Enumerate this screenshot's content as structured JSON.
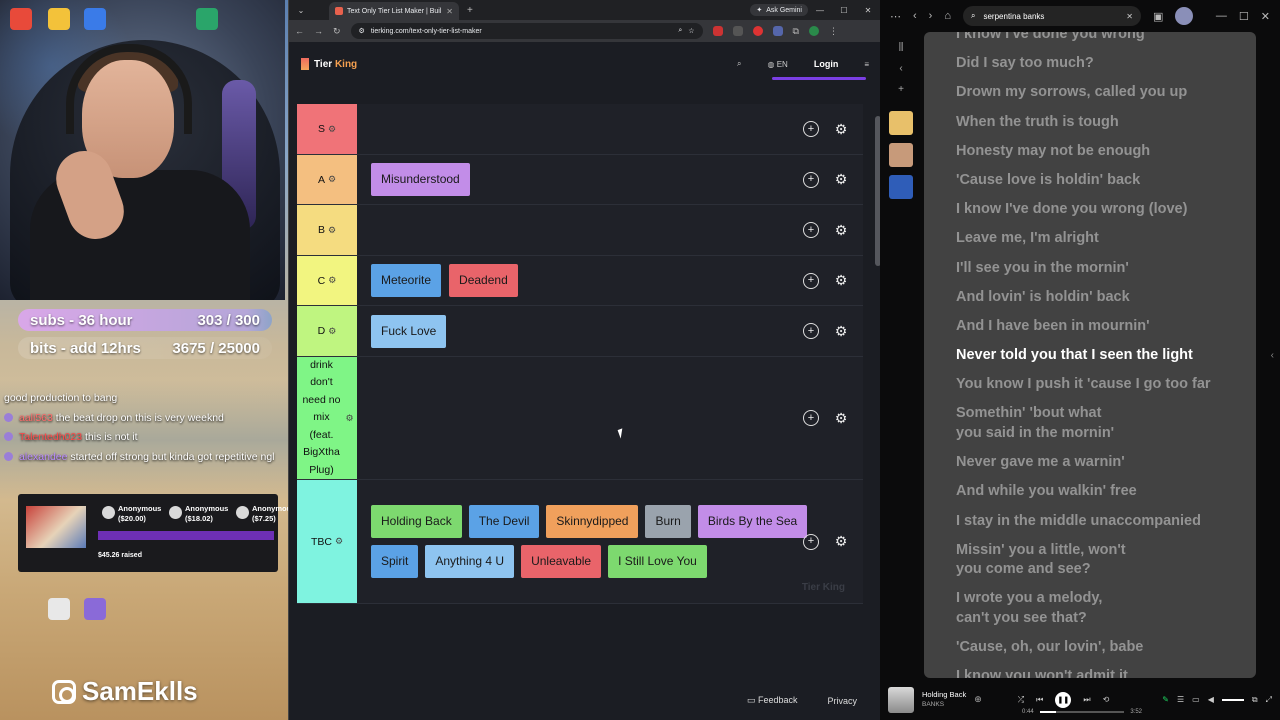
{
  "overlay": {
    "subs_label": "subs - 36 hour",
    "subs_count": "303 / 300",
    "bits_label": "bits - add 12hrs",
    "bits_count": "3675 / 25000",
    "chat": [
      {
        "user": "",
        "text": "good production to bang"
      },
      {
        "user": "aali563",
        "text": "the beat drop on this is very weeknd"
      },
      {
        "user": "Talentedh023",
        "text": "this is not it"
      },
      {
        "user": "alexandee",
        "text": "started off strong but kinda got repetitive ngl"
      }
    ],
    "donations": [
      {
        "name": "Anonymous",
        "amount": "($20.00)"
      },
      {
        "name": "Anonymous",
        "amount": "($18.02)"
      },
      {
        "name": "Anonymou",
        "amount": "($7.25)"
      }
    ],
    "donation_raised": "$45.26 raised",
    "handle": "SamEklls",
    "desktop_icons": [
      "#e84a3a",
      "#f3c23a",
      "#3a7be8",
      "#2aa56a",
      "#e8e8e8",
      "#8a6ad8"
    ]
  },
  "browser": {
    "tab_title": "Text Only Tier List Maker | Buil",
    "gemini": "Ask Gemini",
    "url": "tierking.com/text-only-tier-list-maker",
    "site": {
      "logo_a": "Tier ",
      "logo_b": "King",
      "lang": "EN",
      "login": "Login",
      "feedback": "Feedback",
      "privacy": "Privacy",
      "watermark": "Tier King"
    },
    "tiers": [
      {
        "label": "S",
        "color": "#f07378",
        "height": 51,
        "items": []
      },
      {
        "label": "A",
        "color": "#f4bf80",
        "height": 50,
        "items": [
          {
            "text": "Misunderstood",
            "color": "#c28de8"
          }
        ]
      },
      {
        "label": "B",
        "color": "#f5dc80",
        "height": 51,
        "items": []
      },
      {
        "label": "C",
        "color": "#f2f580",
        "height": 50,
        "items": [
          {
            "text": "Meteorite",
            "color": "#5ba2e6"
          },
          {
            "text": "Deadend",
            "color": "#e9646a"
          }
        ]
      },
      {
        "label": "D",
        "color": "#bff580",
        "height": 51,
        "items": [
          {
            "text": "Fuck Love",
            "color": "#8ec4f0"
          }
        ]
      },
      {
        "label": "drink don't need no mix (feat. BigXtha Plug)",
        "color": "#7ff586",
        "height": 123,
        "items": []
      },
      {
        "label": "TBC",
        "color": "#7ff3e0",
        "height": 124,
        "items": [
          {
            "text": "Holding Back",
            "color": "#7dd96f"
          },
          {
            "text": "The Devil",
            "color": "#5ba2e6"
          },
          {
            "text": "Skinnydipped",
            "color": "#f0a05c"
          },
          {
            "text": "Burn",
            "color": "#9aa3ad"
          },
          {
            "text": "Birds By the Sea",
            "color": "#c28de8"
          },
          {
            "text": "Spirit",
            "color": "#5ba2e6"
          },
          {
            "text": "Anything 4 U",
            "color": "#8ec4f0"
          },
          {
            "text": "Unleavable",
            "color": "#e9646a"
          },
          {
            "text": "I Still Love You",
            "color": "#7dd96f"
          }
        ]
      }
    ]
  },
  "lyrics_app": {
    "search_value": "serpentina banks",
    "current_line_index": 11,
    "lines": [
      "I know I've done you wrong",
      "Did I say too much?",
      "Drown my sorrows, called you up",
      "When the truth is tough",
      "Honesty may not be enough",
      "'Cause love is holdin' back",
      "I know I've done you wrong (love)",
      "Leave me, I'm alright",
      "I'll see you in the mornin'",
      "And lovin' is holdin' back",
      "And I have been in mournin'",
      "Never told you that I seen the light",
      "You know I push it 'cause I go too far",
      "Somethin' 'bout what\nyou said in the mornin'",
      "Never gave me a warnin'",
      "And while you walkin' free",
      "I stay in the middle unaccompanied",
      "Missin' you a little, won't\nyou come and see?",
      "I wrote you a melody,\ncan't you see that?",
      "'Cause, oh, our lovin', babe",
      "I know you won't admit it"
    ],
    "player": {
      "title": "Holding Back",
      "artist": "BANKS",
      "elapsed": "0:44",
      "duration": "3:52",
      "progress_fraction": 0.19
    },
    "sidebar_thumbs": [
      "#e8c06a",
      "#c79a7a",
      "#2f5db8"
    ]
  }
}
